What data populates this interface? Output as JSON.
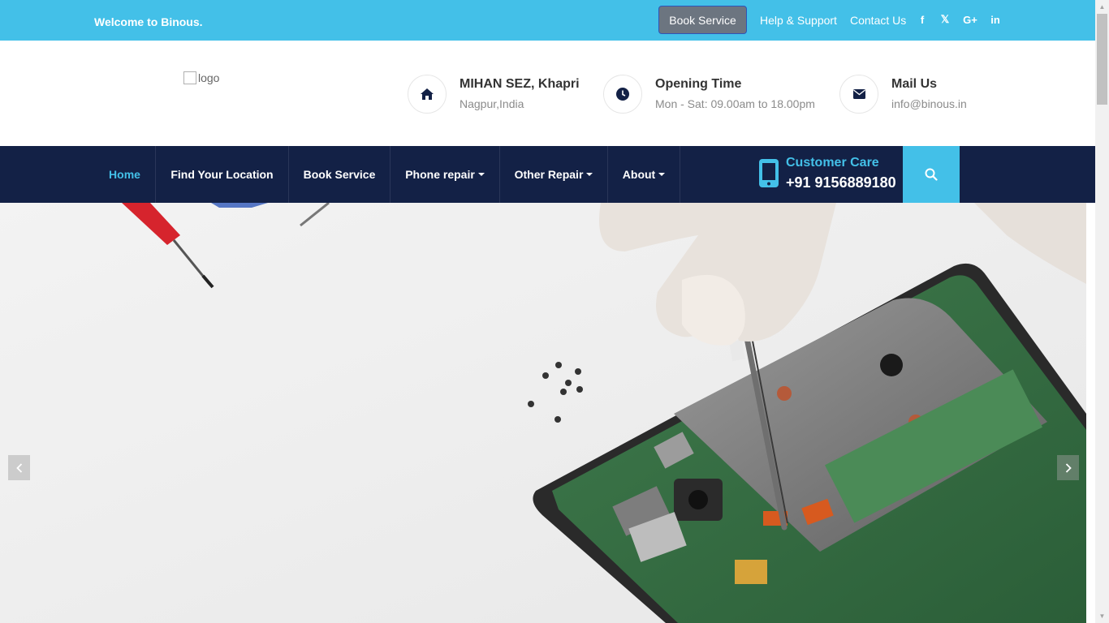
{
  "topbar": {
    "welcome": "Welcome to Binous.",
    "book_service": "Book Service",
    "help_support": "Help & Support",
    "contact_us": "Contact Us",
    "social": [
      {
        "icon": "facebook-icon",
        "glyph": "f"
      },
      {
        "icon": "x-twitter-icon",
        "glyph": "𝕏"
      },
      {
        "icon": "google-plus-icon",
        "glyph": "G+"
      },
      {
        "icon": "linkedin-icon",
        "glyph": "in"
      }
    ]
  },
  "header": {
    "logo_alt": "logo",
    "address": {
      "title": "MIHAN SEZ, Khapri",
      "sub": "Nagpur,India",
      "icon": "home-icon"
    },
    "opening": {
      "title": "Opening Time",
      "sub": "Mon - Sat: 09.00am to 18.00pm",
      "icon": "clock-icon"
    },
    "mail": {
      "title": "Mail Us",
      "sub": "info@binous.in",
      "icon": "envelope-icon"
    }
  },
  "nav": {
    "items": [
      {
        "label": "Home",
        "active": true
      },
      {
        "label": "Find Your Location"
      },
      {
        "label": "Book Service"
      },
      {
        "label": "Phone repair",
        "dropdown": true
      },
      {
        "label": "Other Repair",
        "dropdown": true
      },
      {
        "label": "About",
        "dropdown": true
      }
    ],
    "customer_care_label": "Customer Care",
    "customer_care_number": "+91 9156889180"
  },
  "colors": {
    "accent": "#43c0e8",
    "navy": "#132146",
    "button_gray": "#6c7580"
  }
}
